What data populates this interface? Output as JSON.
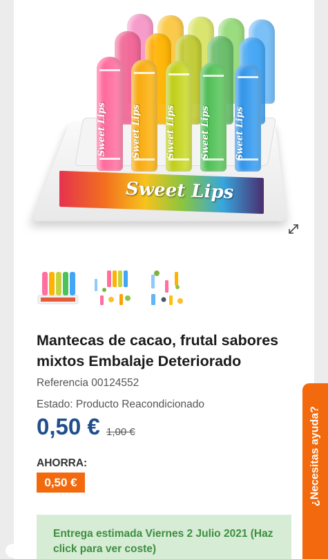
{
  "gallery": {
    "brand_text": "Sweet Lips",
    "thumbnails": [
      "thumbnail-1",
      "thumbnail-2",
      "thumbnail-3"
    ]
  },
  "product": {
    "title": "Mantecas de cacao, frutal sabores mixtos Embalaje Deteriorado",
    "reference": "Referencia 00124552",
    "condition": "Estado: Producto Reacondicionado",
    "price": "0,50 €",
    "old_price": "1,00 €",
    "savings_label": "AHORRA:",
    "savings_value": "0,50 €"
  },
  "delivery": {
    "text": "Entrega estimada Viernes 2 Julio 2021 (Haz click para ver coste)"
  },
  "help": {
    "label": "¿Necesitas ayuda?"
  },
  "colors": {
    "accent_orange": "#f26a0d",
    "price_blue": "#1f4e8c",
    "delivery_green": "#3e8e41",
    "delivery_bg": "#d6ecd5"
  }
}
